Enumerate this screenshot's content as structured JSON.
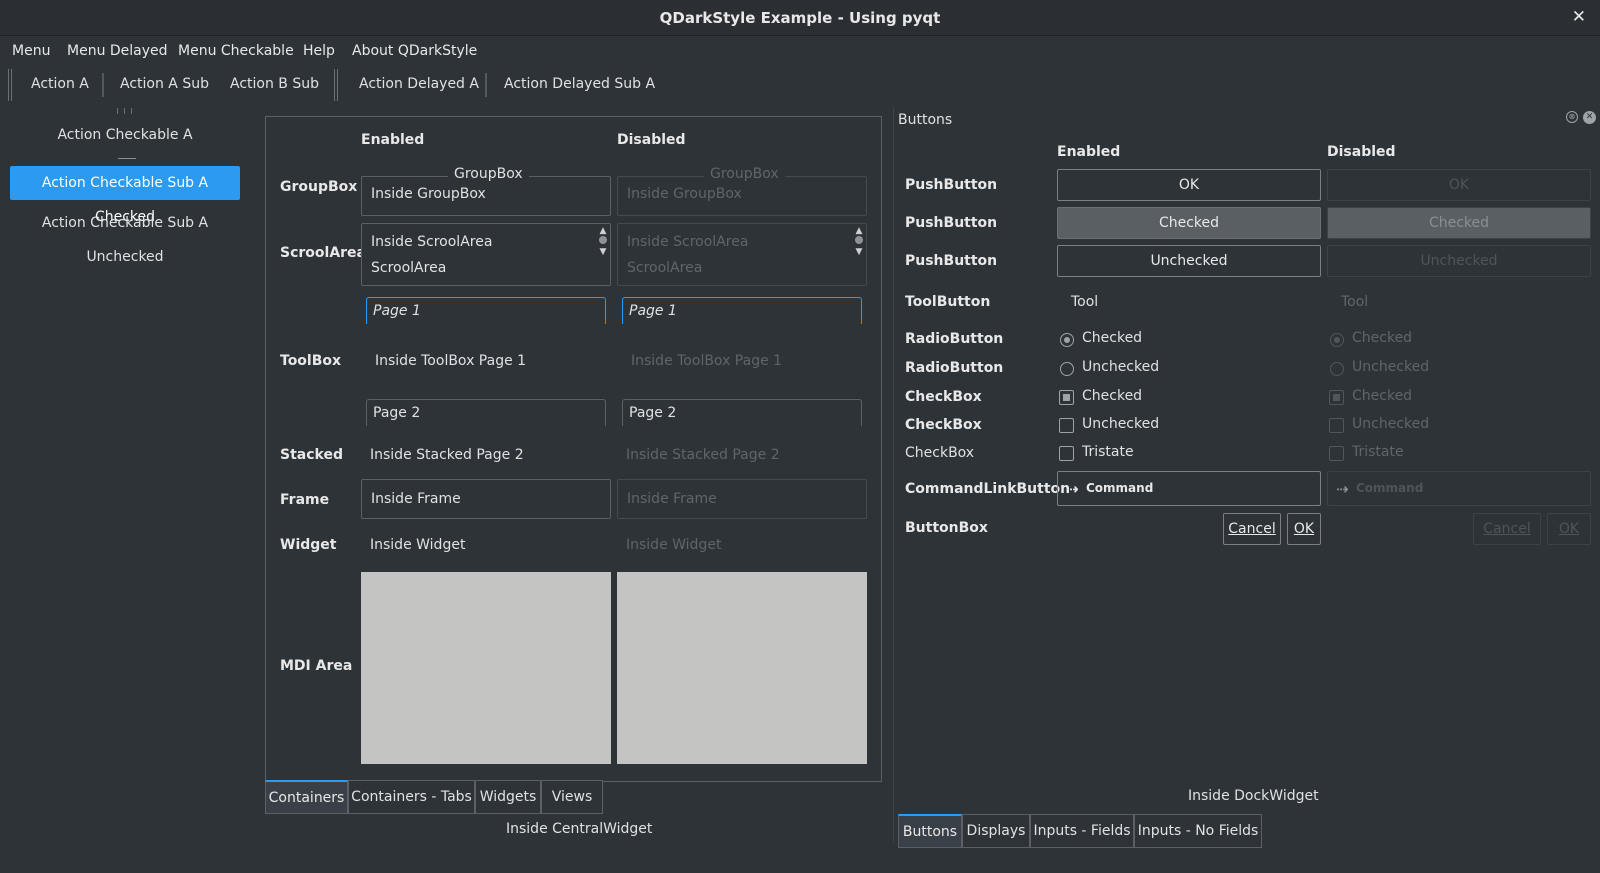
{
  "window": {
    "title": "QDarkStyle Example - Using pyqt",
    "close_glyph": "✕"
  },
  "menubar": [
    "Menu",
    "Menu Delayed",
    "Menu Checkable",
    "Help",
    "About QDarkStyle"
  ],
  "toolbar": [
    "Action A",
    "Action A Sub",
    "Action B Sub",
    "Action Delayed A",
    "Action Delayed Sub A"
  ],
  "left_toolbar": {
    "items": [
      "Action Checkable A",
      "Action Checkable Sub A Checked",
      "Action Checkable Sub A Unchecked"
    ],
    "selected_index": 1
  },
  "central": {
    "col_enabled": "Enabled",
    "col_disabled": "Disabled",
    "rows": {
      "groupbox": "GroupBox",
      "scrollarea": "ScroolArea",
      "toolbox": "ToolBox",
      "stacked": "Stacked",
      "frame": "Frame",
      "widget": "Widget",
      "mdi": "MDI Area"
    },
    "groupbox_title": "GroupBox",
    "groupbox_text": "Inside GroupBox",
    "scroll_line1": "Inside ScroolArea",
    "scroll_line2": "ScroolArea",
    "toolbox_page1": "Page 1",
    "toolbox_inside": "Inside ToolBox Page 1",
    "toolbox_page2": "Page 2",
    "stacked_text": "Inside Stacked Page 2",
    "frame_text": "Inside Frame",
    "widget_text": "Inside Widget",
    "tabs": [
      "Containers",
      "Containers - Tabs",
      "Widgets",
      "Views"
    ],
    "active_tab": 0,
    "caption": "Inside CentralWidget"
  },
  "dock": {
    "title": "Buttons",
    "col_enabled": "Enabled",
    "col_disabled": "Disabled",
    "labels": {
      "push1": "PushButton",
      "push2": "PushButton",
      "push3": "PushButton",
      "tool": "ToolButton",
      "radio1": "RadioButton",
      "radio2": "RadioButton",
      "check1": "CheckBox",
      "check2": "CheckBox",
      "check3": "CheckBox",
      "cmdlink": "CommandLinkButton",
      "buttonbox": "ButtonBox"
    },
    "push_ok": "OK",
    "push_checked": "Checked",
    "push_unchecked": "Unchecked",
    "tool_label": "Tool",
    "radio_checked": "Checked",
    "radio_unchecked": "Unchecked",
    "check_checked": "Checked",
    "check_unchecked": "Unchecked",
    "check_tristate": "Tristate",
    "command_label": "Command",
    "command_arrow": "⇢",
    "bb_cancel": "Cancel",
    "bb_ok": "OK",
    "caption": "Inside DockWidget",
    "tabs": [
      "Buttons",
      "Displays",
      "Inputs - Fields",
      "Inputs - No Fields"
    ],
    "active_tab": 0
  },
  "colors": {
    "accent": "#2b9af0",
    "background": "#2e3338",
    "mdi": "#c4c4c2"
  }
}
